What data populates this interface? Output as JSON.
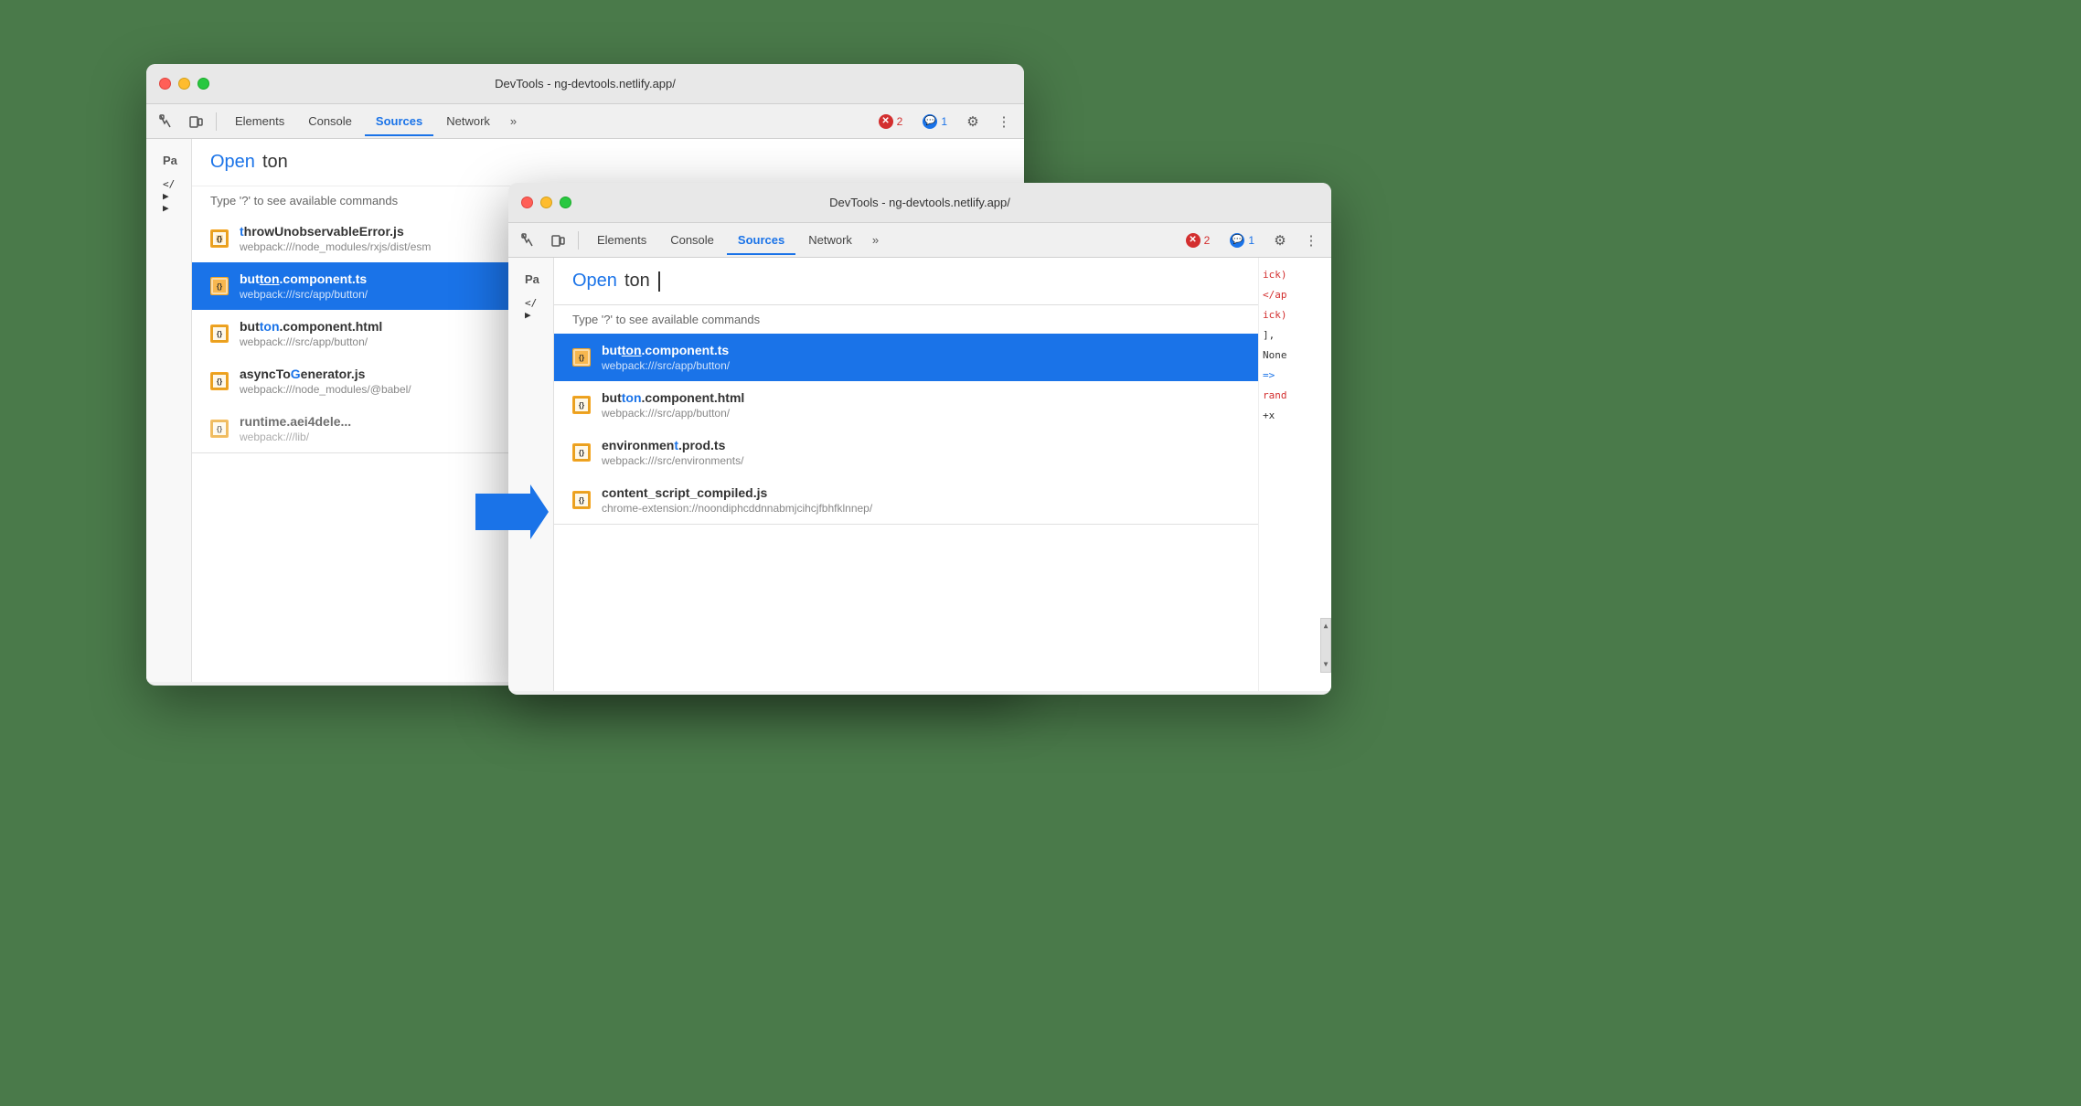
{
  "background_color": "#4a7a4a",
  "window_back": {
    "title": "DevTools - ng-devtools.netlify.app/",
    "tabs": [
      "Elements",
      "Console",
      "Sources",
      "Network"
    ],
    "active_tab": "Sources",
    "more_label": "»",
    "errors": {
      "count": 2,
      "messages": 1
    },
    "sidebar_label": "Pa",
    "command_palette": {
      "open_label": "Open",
      "typed_text": "ton",
      "hint": "Type '?' to see available commands",
      "results": [
        {
          "filename": "throwUnobservableError.js",
          "path": "webpack:///node_modules/rxjs/dist/esm",
          "selected": false,
          "highlight_start": 1,
          "highlight_end": 4
        },
        {
          "filename": "button.component.ts",
          "path": "webpack:///src/app/button/",
          "selected": true,
          "highlight_start": 4,
          "highlight_end": 7
        },
        {
          "filename": "button.component.html",
          "path": "webpack:///src/app/button/",
          "selected": false,
          "highlight_start": 4,
          "highlight_end": 7
        },
        {
          "filename": "asyncToGenerator.js",
          "path": "webpack:///node_modules/@babel/",
          "selected": false,
          "highlight_start": 6,
          "highlight_end": 9
        },
        {
          "filename": "runtime.aei4dele...",
          "path": "webpack:///lib/",
          "selected": false
        }
      ]
    }
  },
  "window_front": {
    "title": "DevTools - ng-devtools.netlify.app/",
    "tabs": [
      "Elements",
      "Console",
      "Sources",
      "Network"
    ],
    "active_tab": "Sources",
    "more_label": "»",
    "errors": {
      "count": 2,
      "messages": 1
    },
    "sidebar_label": "Pa",
    "command_palette": {
      "open_label": "Open",
      "typed_text": "ton",
      "hint": "Type '?' to see available commands",
      "results": [
        {
          "filename": "button.component.ts",
          "path": "webpack:///src/app/button/",
          "selected": true,
          "highlight_before": "but",
          "highlight": "ton",
          "highlight_after": ".component.ts"
        },
        {
          "filename": "button.component.html",
          "path": "webpack:///src/app/button/",
          "selected": false,
          "highlight_before": "but",
          "highlight": "ton",
          "highlight_after": ".component.html"
        },
        {
          "filename": "environment.prod.ts",
          "path": "webpack:///src/environments/",
          "selected": false,
          "highlight_before": "environmen",
          "highlight": "t.p",
          "highlight_after": "rod.ts"
        },
        {
          "filename": "content_script_compiled.js",
          "path": "chrome-extension://noondiphcddnnabmjcihcjfbhfklnnep/",
          "selected": false
        }
      ]
    },
    "code_snippets": [
      "ick)",
      "</ap",
      "ick)",
      "], ",
      "None",
      "=>",
      "rand",
      "+x"
    ]
  },
  "arrow": {
    "color": "#1a73e8"
  }
}
